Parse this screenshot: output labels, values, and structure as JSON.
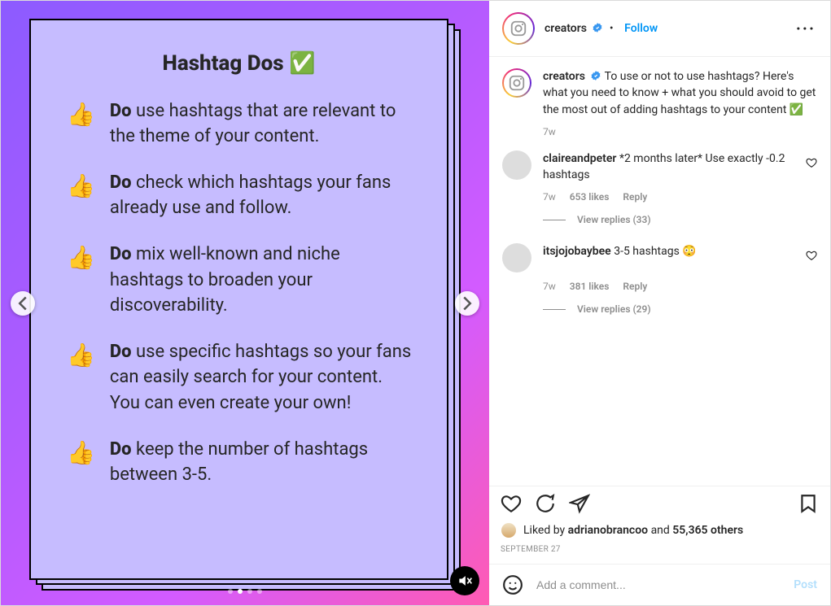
{
  "media": {
    "card_title": "Hashtag Dos ✅",
    "tips": [
      "use hashtags that are relevant to the theme of your content.",
      "check which hashtags your fans already use and follow.",
      "mix well-known and niche hashtags to broaden your discoverability.",
      "use specific hashtags so your fans can easily search for your content. You can even create your own!",
      "keep the number of hashtags between 3-5."
    ],
    "do_label": "Do",
    "dots_total": 4,
    "dots_active_index": 1
  },
  "header": {
    "username": "creators",
    "follow": "Follow"
  },
  "caption": {
    "username": "creators",
    "text": "To use or not to use hashtags? Here's what you need to know + what you should avoid to get the most out of adding hashtags to your content ✅",
    "age": "7w"
  },
  "comments": [
    {
      "username": "claireandpeter",
      "text": "*2 months later* Use exactly -0.2 hashtags",
      "age": "7w",
      "likes": "653 likes",
      "replies_label": "View replies (33)"
    },
    {
      "username": "itsjojobaybee",
      "text": "3-5 hashtags 😳",
      "age": "7w",
      "likes": "381 likes",
      "replies_label": "View replies (29)"
    }
  ],
  "reply_label": "Reply",
  "liked_by": {
    "prefix": "Liked by ",
    "name": "adrianobrancoo",
    "and": " and ",
    "others": "55,365 others"
  },
  "date": "SEPTEMBER 27",
  "comment_box": {
    "placeholder": "Add a comment...",
    "post": "Post"
  }
}
